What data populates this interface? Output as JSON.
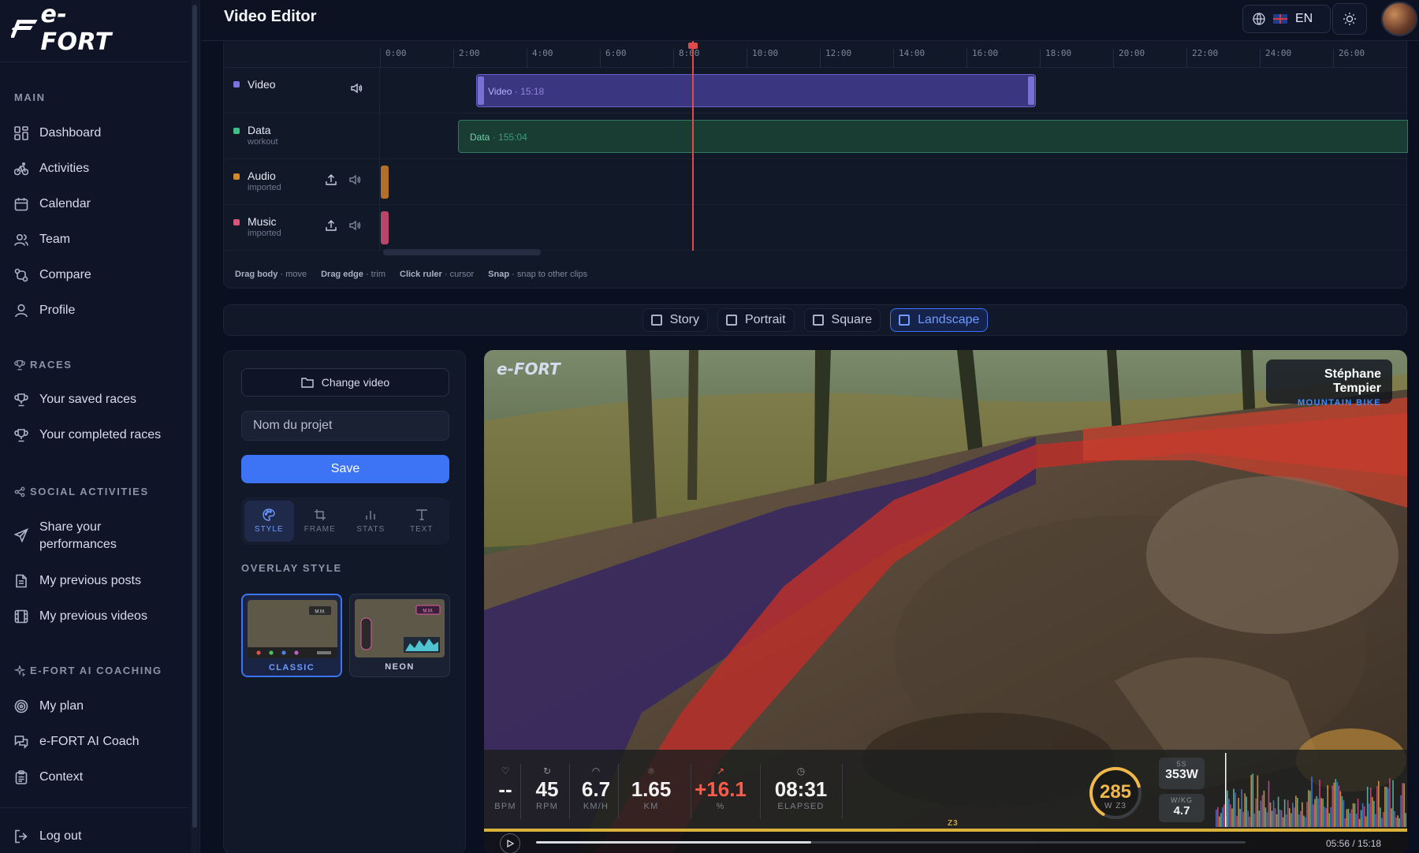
{
  "brand": {
    "logo_text": "e-FORT"
  },
  "header": {
    "title": "Video Editor",
    "language": "EN"
  },
  "sidebar": {
    "sections": [
      {
        "label": "MAIN"
      },
      {
        "label": "RACES"
      },
      {
        "label": "SOCIAL ACTIVITIES"
      },
      {
        "label": "E-FORT AI COACHING"
      }
    ],
    "items": [
      {
        "label": "Dashboard",
        "icon": "grid-icon"
      },
      {
        "label": "Activities",
        "icon": "bike-icon"
      },
      {
        "label": "Calendar",
        "icon": "calendar-icon"
      },
      {
        "label": "Team",
        "icon": "team-icon"
      },
      {
        "label": "Compare",
        "icon": "compare-icon"
      },
      {
        "label": "Profile",
        "icon": "user-icon"
      },
      {
        "label": "Your saved races",
        "icon": "trophy-icon"
      },
      {
        "label": "Your completed races",
        "icon": "trophy-icon"
      },
      {
        "label": "Share your performances",
        "icon": "send-icon"
      },
      {
        "label": "My previous posts",
        "icon": "document-icon"
      },
      {
        "label": "My previous videos",
        "icon": "film-icon"
      },
      {
        "label": "My plan",
        "icon": "target-icon"
      },
      {
        "label": "e-FORT AI Coach",
        "icon": "chat-icon"
      },
      {
        "label": "Context",
        "icon": "clipboard-icon"
      }
    ],
    "logout": "Log out"
  },
  "timeline": {
    "ticks": [
      "0:00",
      "2:00",
      "4:00",
      "6:00",
      "8:00",
      "10:00",
      "12:00",
      "14:00",
      "16:00",
      "18:00",
      "20:00",
      "22:00",
      "24:00",
      "26:00"
    ],
    "tracks": [
      {
        "name": "Video",
        "sub": "",
        "color": "#7b74e0"
      },
      {
        "name": "Data",
        "sub": "workout",
        "color": "#3fbf86"
      },
      {
        "name": "Audio",
        "sub": "imported",
        "color": "#d08a2c"
      },
      {
        "name": "Music",
        "sub": "imported",
        "color": "#d8547a"
      }
    ],
    "clips": {
      "video": {
        "label": "Video",
        "duration": "15:18"
      },
      "data": {
        "label": "Data",
        "duration": "155:04"
      }
    },
    "hints": [
      {
        "key": "Drag body",
        "desc": "move"
      },
      {
        "key": "Drag edge",
        "desc": "trim"
      },
      {
        "key": "Click ruler",
        "desc": "cursor"
      },
      {
        "key": "Snap",
        "desc": "snap to other clips"
      }
    ]
  },
  "formats": {
    "options": [
      "Story",
      "Portrait",
      "Square",
      "Landscape"
    ],
    "selected": "Landscape"
  },
  "panel": {
    "change_video": "Change video",
    "project_placeholder": "Nom du projet",
    "save": "Save",
    "tabs": [
      "STYLE",
      "FRAME",
      "STATS",
      "TEXT"
    ],
    "active_tab": "STYLE",
    "overlay_label": "OVERLAY STYLE",
    "styles": [
      "CLASSIC",
      "NEON"
    ],
    "selected_style": "CLASSIC",
    "thumb_badge": "M.M."
  },
  "preview": {
    "logo_text": "e-FORT",
    "rider_name": "Stéphane Tempier",
    "rider_sport": "MOUNTAIN BIKE",
    "stats": [
      {
        "value": "--",
        "label": "BPM",
        "icon": "heart-icon"
      },
      {
        "value": "45",
        "label": "RPM",
        "icon": "cadence-icon"
      },
      {
        "value": "6.7",
        "label": "KM/H",
        "icon": "speed-icon"
      },
      {
        "value": "1.65",
        "label": "KM",
        "icon": "pin-icon"
      },
      {
        "value": "+16.1",
        "label": "%",
        "icon": "slope-icon"
      },
      {
        "value": "08:31",
        "label": "ELAPSED",
        "icon": "timer-icon"
      }
    ],
    "power": {
      "value": "285",
      "sub": "W Z3",
      "ring_fraction": 0.62
    },
    "power_5s": {
      "label": "5S",
      "value": "353W"
    },
    "wkg": {
      "label": "W/KG",
      "value": "4.7"
    },
    "zone": "Z3",
    "time": "05:56 / 15:18",
    "progress_fraction": 0.388,
    "colors": {
      "accent": "#3d73f5",
      "power": "#f0b84a",
      "slope": "#ff5a4a"
    }
  }
}
